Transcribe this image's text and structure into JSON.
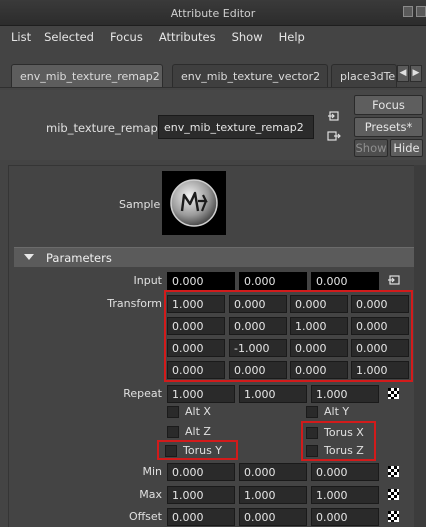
{
  "window": {
    "title": "Attribute Editor"
  },
  "menubar": [
    "List",
    "Selected",
    "Focus",
    "Attributes",
    "Show",
    "Help"
  ],
  "tabs": [
    {
      "label": "env_mib_texture_remap2",
      "active": true
    },
    {
      "label": "env_mib_texture_vector2",
      "active": false
    },
    {
      "label": "place3dTe",
      "active": false
    }
  ],
  "tab_arrows": {
    "left": "◀",
    "right": "▶"
  },
  "node": {
    "label": "mib_texture_remap:",
    "value": "env_mib_texture_remap2"
  },
  "buttons": {
    "focus": "Focus",
    "presets": "Presets*",
    "show": "Show",
    "hide": "Hide"
  },
  "sample": {
    "label": "Sample",
    "logo_text": "Maya"
  },
  "section": {
    "title": "Parameters"
  },
  "input": {
    "label": "Input",
    "values": [
      "0.000",
      "0.000",
      "0.000"
    ]
  },
  "transform": {
    "label": "Transform",
    "matrix": [
      [
        "1.000",
        "0.000",
        "0.000",
        "0.000"
      ],
      [
        "0.000",
        "0.000",
        "1.000",
        "0.000"
      ],
      [
        "0.000",
        "-1.000",
        "0.000",
        "0.000"
      ],
      [
        "0.000",
        "0.000",
        "0.000",
        "1.000"
      ]
    ]
  },
  "repeat": {
    "label": "Repeat",
    "values": [
      "1.000",
      "1.000",
      "1.000"
    ]
  },
  "checkboxes": {
    "alt_x": "Alt X",
    "alt_y": "Alt Y",
    "alt_z": "Alt Z",
    "torus_x": "Torus X",
    "torus_y": "Torus Y",
    "torus_z": "Torus Z"
  },
  "min": {
    "label": "Min",
    "values": [
      "0.000",
      "0.000",
      "0.000"
    ]
  },
  "max": {
    "label": "Max",
    "values": [
      "1.000",
      "1.000",
      "1.000"
    ]
  },
  "offset": {
    "label": "Offset",
    "values": [
      "0.000",
      "0.000",
      "0.000"
    ]
  },
  "colors": {
    "highlight_box": "#d21b1b",
    "panel_bg": "#444444",
    "field_bg": "#2a2a2a"
  }
}
